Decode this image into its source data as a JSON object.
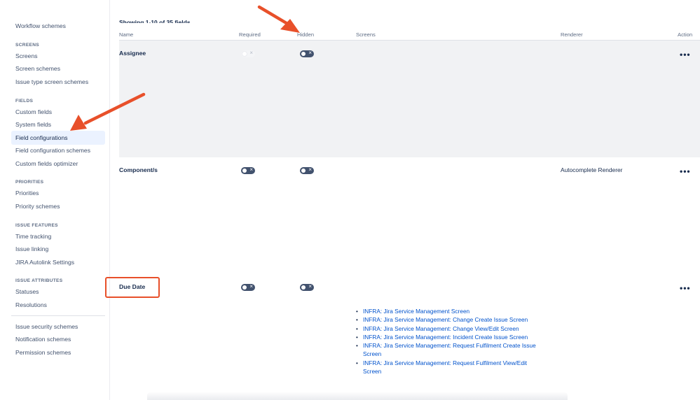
{
  "sidebar": {
    "top_item": "Workflow schemes",
    "sections": [
      {
        "heading": "SCREENS",
        "items": [
          "Screens",
          "Screen schemes",
          "Issue type screen schemes"
        ]
      },
      {
        "heading": "FIELDS",
        "items": [
          "Custom fields",
          "System fields",
          "Field configurations",
          "Field configuration schemes",
          "Custom fields optimizer"
        ]
      },
      {
        "heading": "PRIORITIES",
        "items": [
          "Priorities",
          "Priority schemes"
        ]
      },
      {
        "heading": "ISSUE FEATURES",
        "items": [
          "Time tracking",
          "Issue linking",
          "JIRA Autolink Settings"
        ]
      },
      {
        "heading": "ISSUE ATTRIBUTES",
        "items": [
          "Statuses",
          "Resolutions"
        ]
      }
    ],
    "bottom_items": [
      "Issue security schemes",
      "Notification schemes",
      "Permission schemes"
    ],
    "selected_item": "Field configurations"
  },
  "table": {
    "showing": "Showing 1-10 of 35 fields",
    "headers": {
      "name": "Name",
      "required": "Required",
      "hidden": "Hidden",
      "screens": "Screens",
      "renderer": "Renderer",
      "actions": "Action"
    },
    "toggle_off_glyph": "×",
    "more_glyph": "•••",
    "rows": [
      {
        "name": "Assignee",
        "required": "off-disabled",
        "hidden": "off",
        "renderer": "",
        "screens": []
      },
      {
        "name": "Component/s",
        "required": "off",
        "hidden": "off",
        "renderer": "Autocomplete Renderer",
        "screens": []
      },
      {
        "name": "Due Date",
        "required": "off",
        "hidden": "off",
        "renderer": "",
        "screens": [
          "INFRA: Jira Service Management Screen",
          "INFRA: Jira Service Management: Change Create Issue Screen",
          "INFRA: Jira Service Management: Change View/Edit Screen",
          "INFRA: Jira Service Management: Incident Create Issue Screen",
          "INFRA: Jira Service Management: Request Fulfilment Create Issue Screen",
          "INFRA: Jira Service Management: Request Fulfilment View/Edit Screen"
        ]
      }
    ]
  },
  "colors": {
    "annotation": "#e8502a",
    "link": "#0052cc",
    "toggle": "#42526e",
    "row_highlight": "#f1f2f4"
  }
}
